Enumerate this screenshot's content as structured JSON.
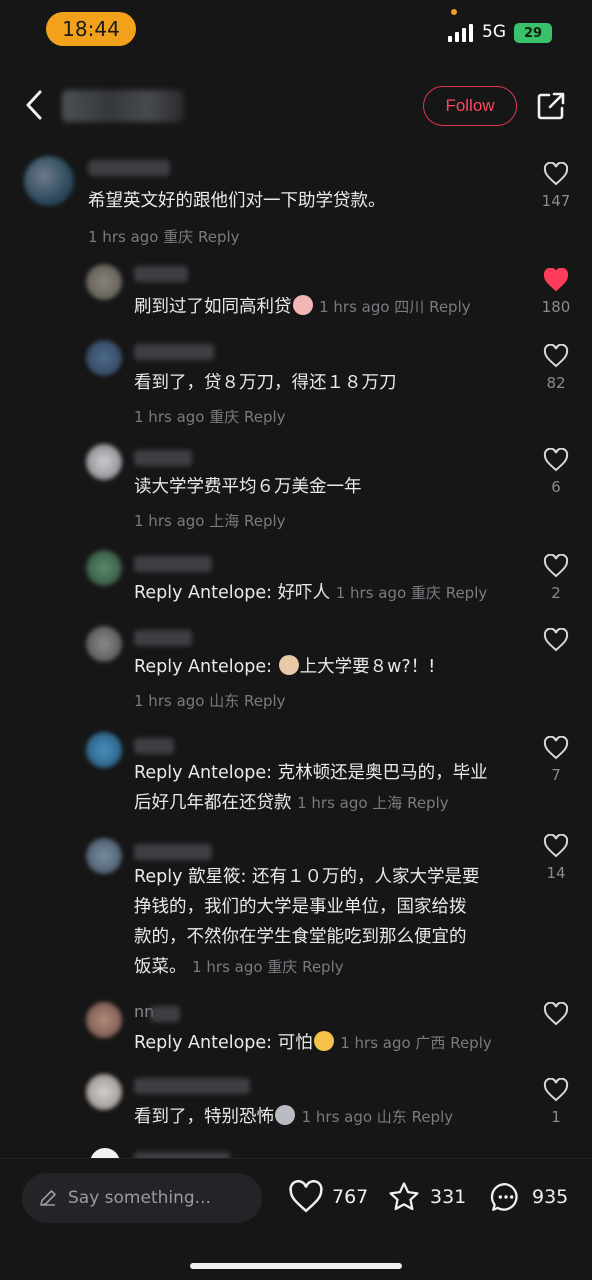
{
  "status": {
    "time": "18:44",
    "network": "5G",
    "battery": "29"
  },
  "header": {
    "follow_label": "Follow"
  },
  "comments": [
    {
      "text": "希望英文好的跟他们对一下助学贷款。",
      "meta": "1 hrs ago 重庆 Reply",
      "likes": "147",
      "liked": false
    },
    {
      "text": "刷到过了如同高利贷",
      "meta": "1 hrs ago 四川 Reply",
      "likes": "180",
      "liked": true
    },
    {
      "text": "看到了，贷８万刀，得还１８万刀",
      "meta": "1 hrs ago 重庆 Reply",
      "likes": "82",
      "liked": false
    },
    {
      "text": "读大学学费平均６万美金一年",
      "meta": "1 hrs ago 上海 Reply",
      "likes": "6",
      "liked": false
    },
    {
      "reply_prefix": "Reply Antelope: ",
      "text": "好吓人",
      "meta": "1 hrs ago 重庆 Reply",
      "likes": "2",
      "liked": false
    },
    {
      "reply_prefix": "Reply Antelope: ",
      "text": "上大学要８w?！!",
      "meta": "1 hrs ago 山东 Reply",
      "likes": "",
      "liked": false
    },
    {
      "reply_prefix": "Reply Antelope: ",
      "text_line1": "克林顿还是奥巴马的，毕业",
      "text_line2": "后好几年都在还贷款",
      "meta": "1 hrs ago 上海 Reply",
      "likes": "7",
      "liked": false
    },
    {
      "reply_prefix": "Reply 歆星筱: ",
      "text_line1": "还有１０万的，人家大学是要",
      "text_line2": "挣钱的，我们的大学是事业单位，国家给拨",
      "text_line3": "款的，不然你在学生食堂能吃到那么便宜的",
      "text_line4": "饭菜。",
      "meta": "1 hrs ago 重庆 Reply",
      "likes": "14",
      "liked": false
    },
    {
      "name_partial": "nn",
      "reply_prefix": "Reply Antelope: ",
      "text": "可怕",
      "meta": "1 hrs ago 广西 Reply",
      "likes": "",
      "liked": false
    },
    {
      "text": "看到了，特别恐怖",
      "meta": "1 hrs ago 山东 Reply",
      "likes": "1",
      "liked": false
    }
  ],
  "bottom": {
    "placeholder": "Say something...",
    "likes": "767",
    "favorites": "331",
    "comments": "935"
  },
  "colors": {
    "accent": "#ff4560",
    "liked": "#ff3b5c",
    "pill": "#f2a21a"
  }
}
